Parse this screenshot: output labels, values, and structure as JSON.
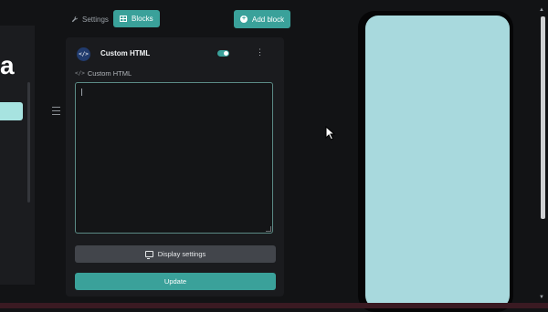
{
  "app": {
    "logo_letter": "a"
  },
  "toolbar": {
    "settings_label": "Settings",
    "blocks_label": "Blocks",
    "add_block_label": "Add block"
  },
  "block": {
    "title": "Custom HTML",
    "icon_glyph": "</>",
    "enabled": true,
    "field_label": "Custom HTML",
    "code_value": "",
    "display_settings_label": "Display settings",
    "update_label": "Update"
  },
  "preview": {
    "screen_color": "#a8d9dd"
  },
  "colors": {
    "accent": "#3aa19a",
    "background": "#121315",
    "panel": "#1a1b1e"
  },
  "icons": [
    "wrench-icon",
    "grid-icon",
    "plus-circle-icon",
    "code-icon",
    "toggle-switch",
    "kebab-icon",
    "monitor-icon",
    "drag-handle-icon"
  ]
}
